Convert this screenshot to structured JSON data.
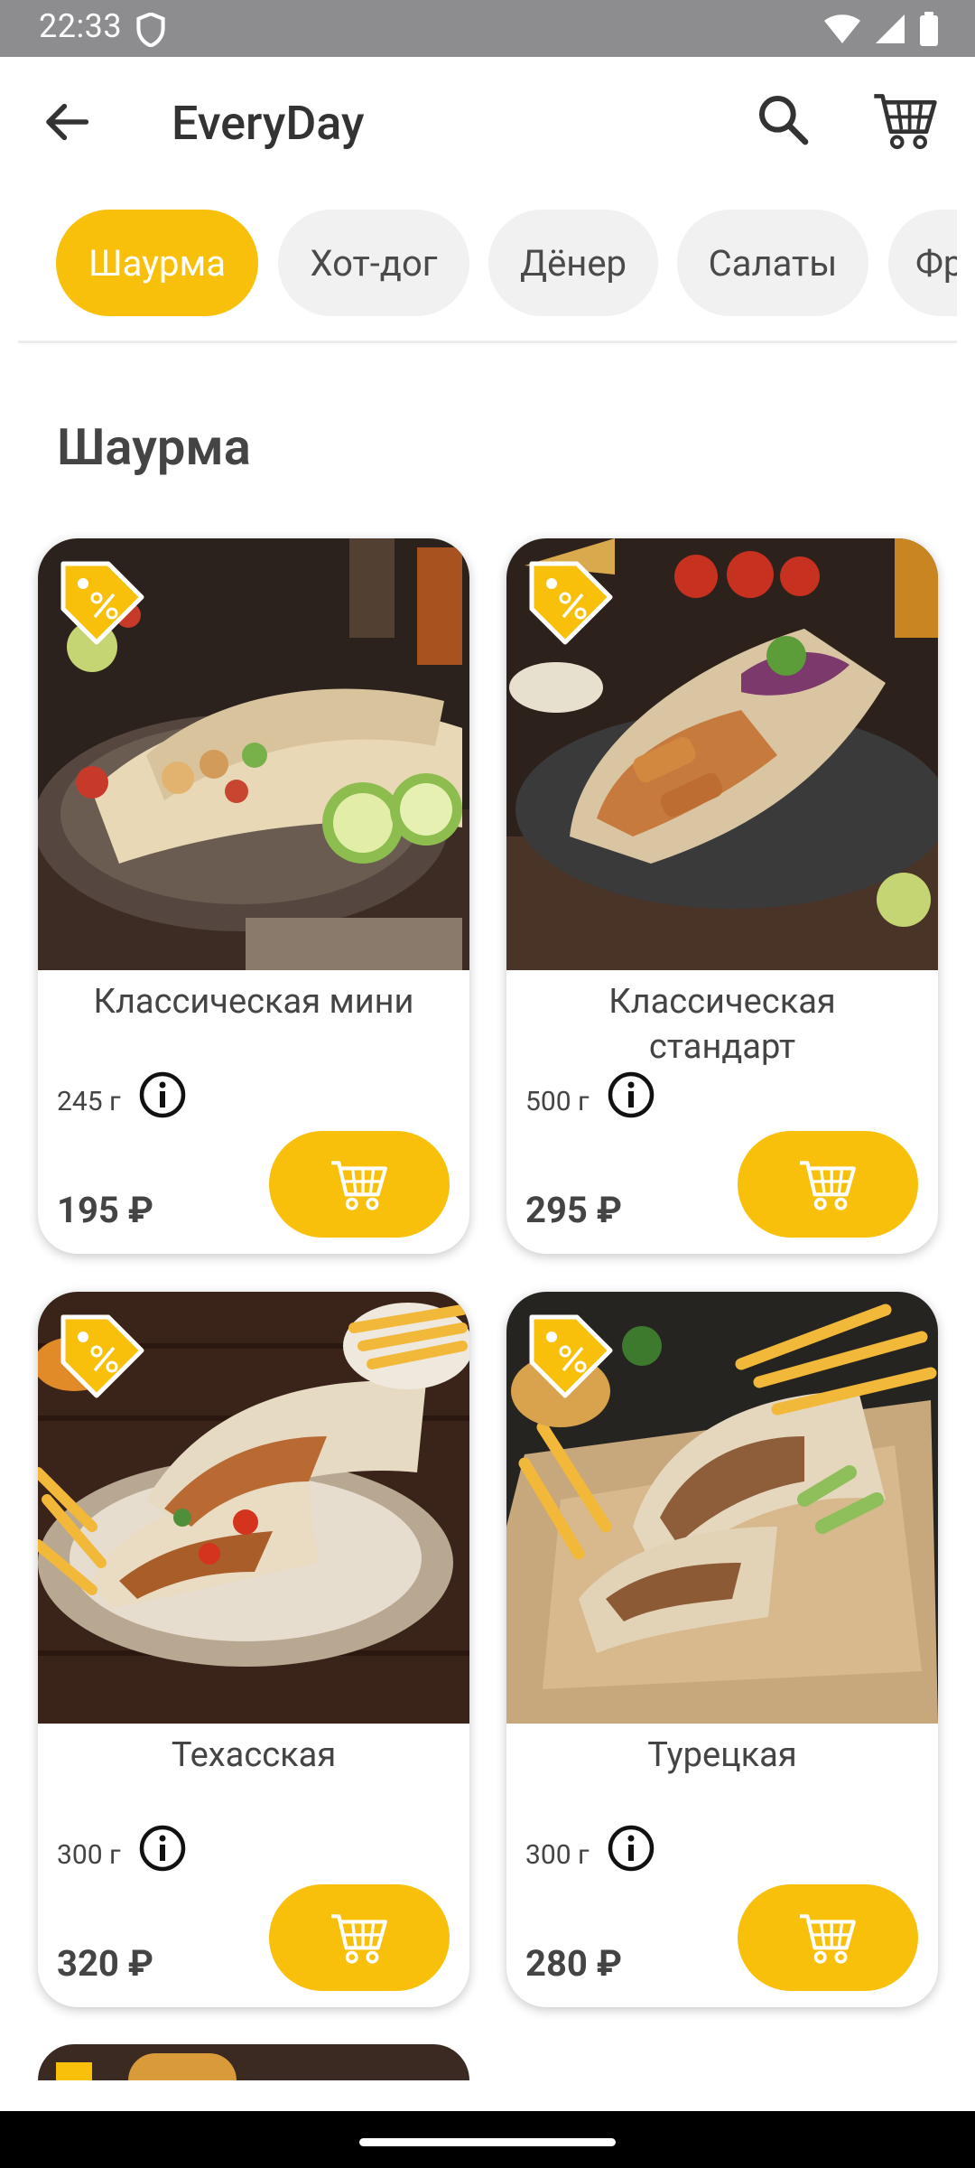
{
  "status": {
    "time": "22:33"
  },
  "app": {
    "title": "EveryDay"
  },
  "categories": [
    {
      "label": "Шаурма",
      "active": true
    },
    {
      "label": "Хот-дог",
      "active": false
    },
    {
      "label": "Дёнер",
      "active": false
    },
    {
      "label": "Салаты",
      "active": false
    },
    {
      "label": "Фр",
      "active": false
    }
  ],
  "section": {
    "title": "Шаурма"
  },
  "products": [
    {
      "name": "Классическая мини",
      "weight": "245 г",
      "price": "195 ₽",
      "image": "wrap-plate-cucumber"
    },
    {
      "name": "Классическая стандарт",
      "weight": "500 г",
      "price": "295 ₽",
      "image": "wrap-dark-plate-tomato"
    },
    {
      "name": "Техасская",
      "weight": "300 г",
      "price": "320 ₽",
      "image": "wrap-fries-plate"
    },
    {
      "name": "Турецкая",
      "weight": "300 г",
      "price": "280 ₽",
      "image": "wrap-paper-fries"
    }
  ],
  "colors": {
    "accent": "#f8bf0b",
    "chip_bg": "#f1f1f1",
    "statusbar": "#8d8d8f"
  },
  "icons": {
    "back": "arrow-left-icon",
    "search": "search-icon",
    "cart": "cart-icon",
    "info": "info-icon",
    "discount": "discount-tag-icon"
  }
}
